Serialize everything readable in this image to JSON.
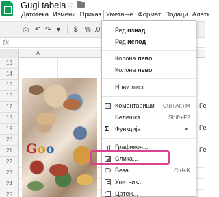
{
  "app": {
    "title": "Gugl tabela"
  },
  "menubar": {
    "items": [
      "Датотека",
      "Измени",
      "Приказ",
      "Уметање",
      "Формат",
      "Подаци",
      "Алатк"
    ],
    "active_index": 3
  },
  "toolbar": {
    "currency_symbol": "$",
    "percent_symbol": "%",
    "decimal_label": ".0"
  },
  "formula_bar": {
    "fx_label": "fx"
  },
  "grid": {
    "column_headers": [
      "A",
      "B"
    ],
    "row_numbers": [
      "13",
      "14",
      "15",
      "16",
      "17",
      "18",
      "19",
      "20",
      "21",
      "22",
      "23",
      "24",
      "25",
      "26",
      "27",
      "28",
      "29",
      "30",
      "31"
    ],
    "right_cells": [
      "Fe",
      "Fe",
      "Fe"
    ]
  },
  "image_logo_text": "Goo",
  "insert_menu": {
    "items": [
      {
        "prefix": "Ред ",
        "bold": "изнад",
        "shortcut": ""
      },
      {
        "prefix": "Ред ",
        "bold": "испод",
        "shortcut": ""
      },
      {
        "prefix": "Колона ",
        "bold": "лево",
        "shortcut": ""
      },
      {
        "prefix": "Колона ",
        "bold": "лево",
        "shortcut": ""
      },
      {
        "prefix": "Нови лист",
        "bold": "",
        "shortcut": ""
      },
      {
        "prefix": "Коментариши",
        "bold": "",
        "shortcut": "Ctrl+Alt+M"
      },
      {
        "prefix": "Белешка",
        "bold": "",
        "shortcut": "Shift+F2"
      },
      {
        "prefix": "Функција",
        "bold": "",
        "shortcut": "►"
      },
      {
        "prefix": "Графикон...",
        "bold": "",
        "shortcut": ""
      },
      {
        "prefix": "Слика...",
        "bold": "",
        "shortcut": ""
      },
      {
        "prefix": "Веза...",
        "bold": "",
        "shortcut": "Ctrl+K"
      },
      {
        "prefix": "Упитник...",
        "bold": "",
        "shortcut": ""
      },
      {
        "prefix": "Цртеж...",
        "bold": "",
        "shortcut": ""
      }
    ],
    "highlighted_item": "Слика..."
  },
  "colors": {
    "sheets_green": "#0f9d58",
    "highlight_pink": "#d9448e"
  }
}
